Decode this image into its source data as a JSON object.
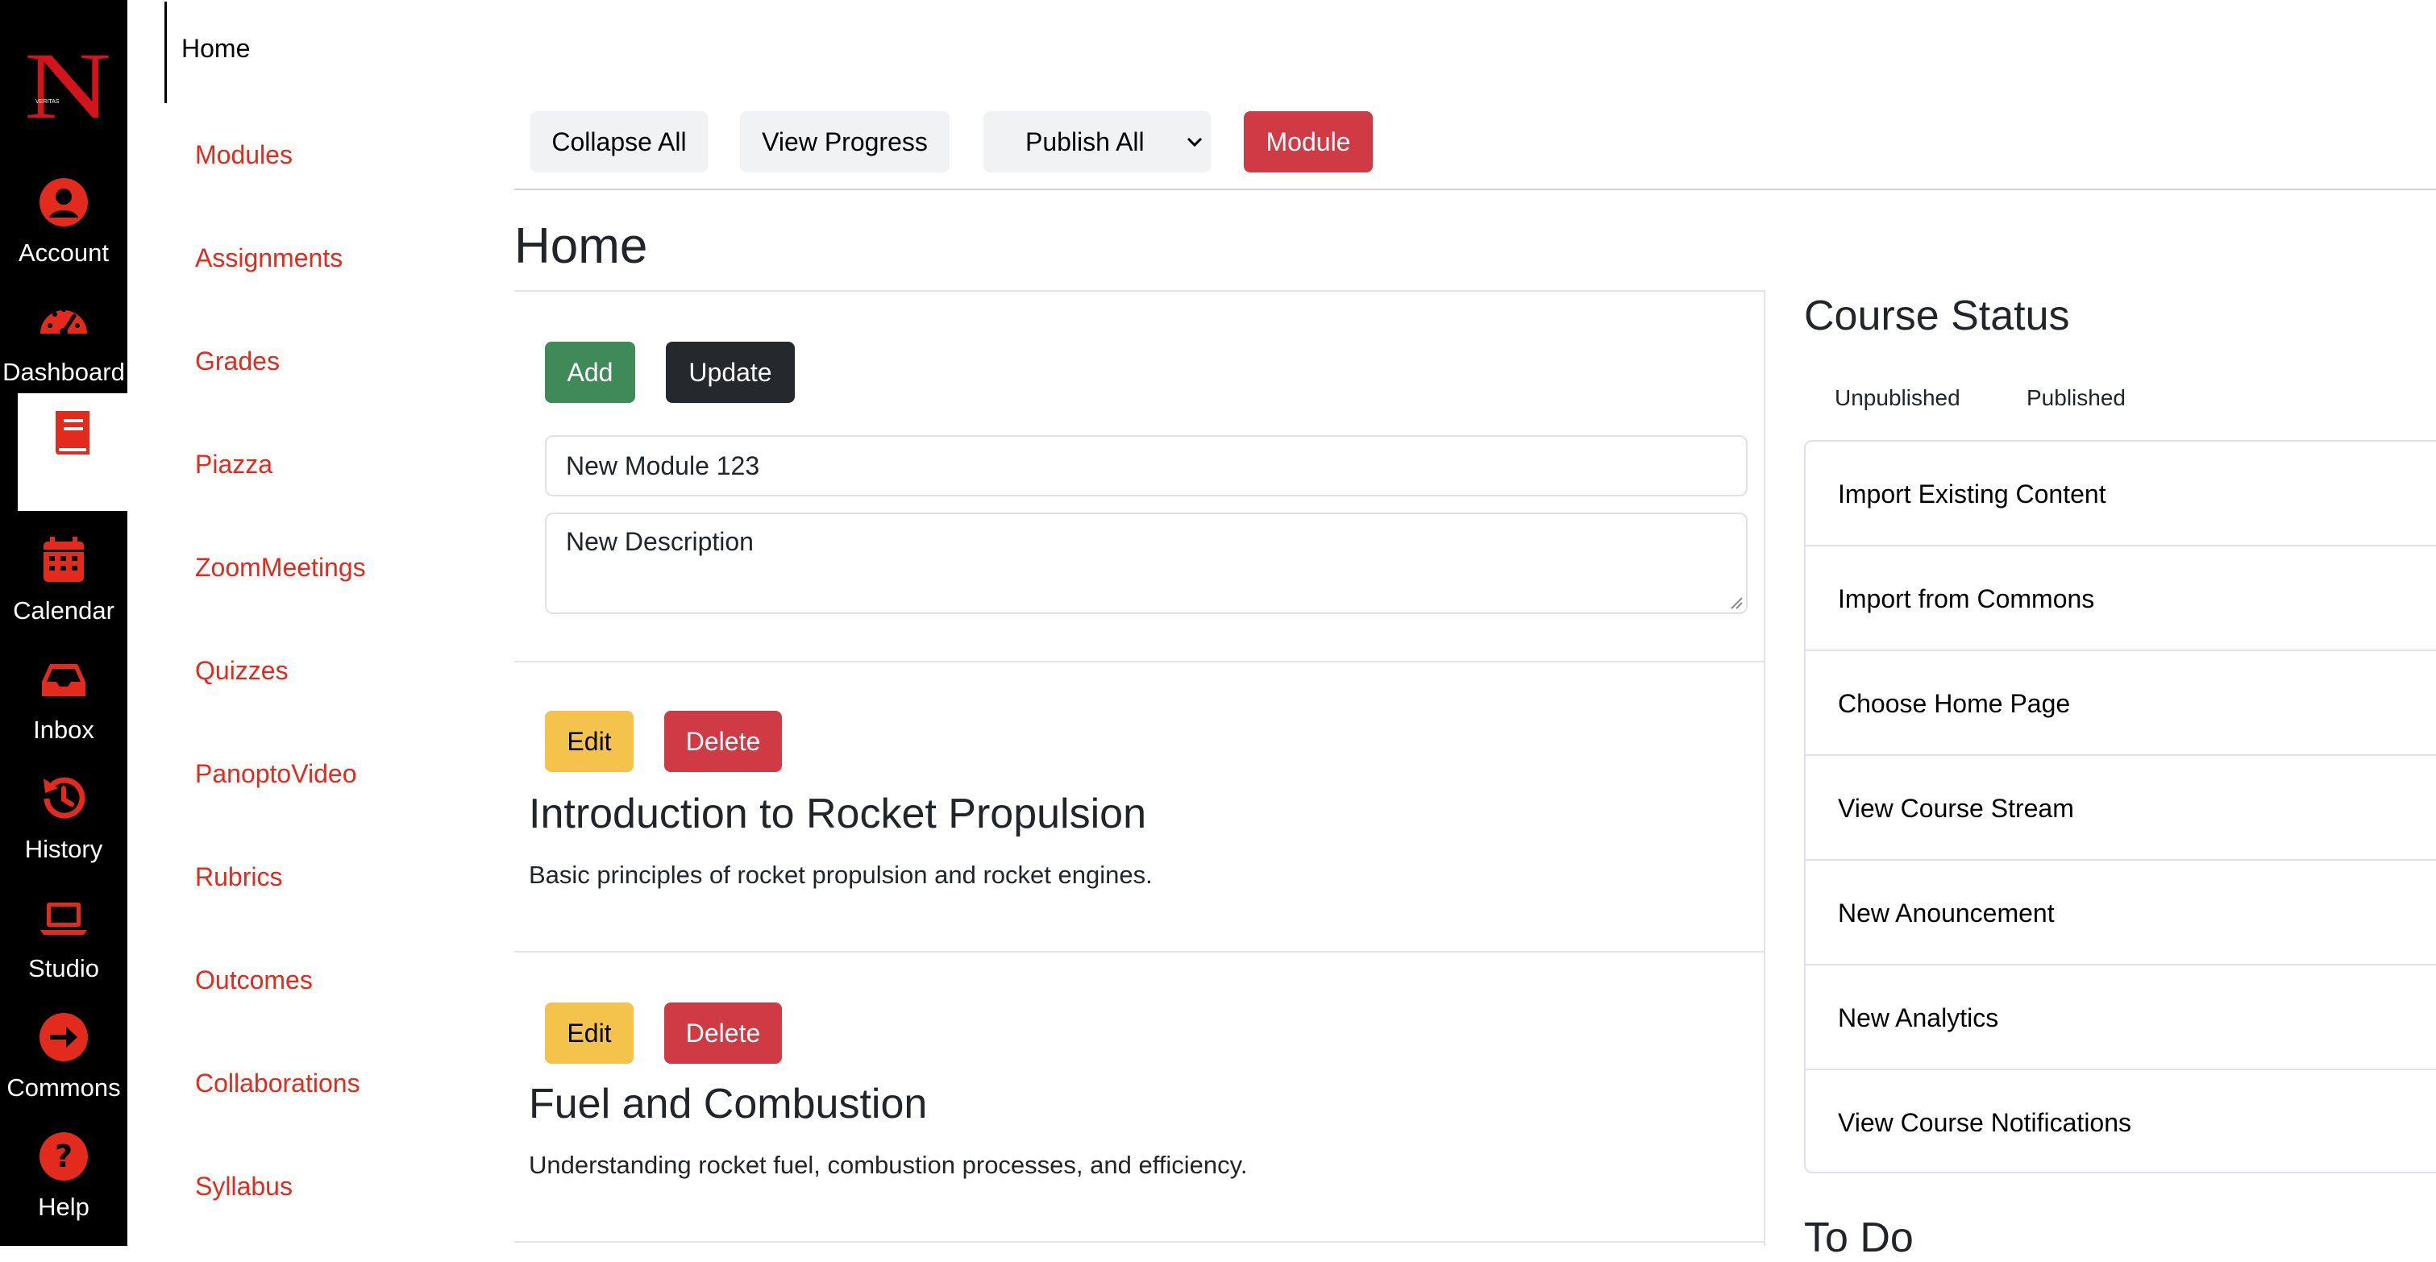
{
  "global_nav": {
    "logo_alt": "N",
    "items": [
      {
        "label": "Account",
        "icon": "account-icon"
      },
      {
        "label": "Dashboard",
        "icon": "dashboard-icon"
      },
      {
        "label": "",
        "icon": "book-icon"
      },
      {
        "label": "Calendar",
        "icon": "calendar-icon"
      },
      {
        "label": "Inbox",
        "icon": "inbox-icon"
      },
      {
        "label": "History",
        "icon": "history-icon"
      },
      {
        "label": "Studio",
        "icon": "laptop-icon"
      },
      {
        "label": "Commons",
        "icon": "arrow-right-circle-icon"
      },
      {
        "label": "Help",
        "icon": "help-icon"
      }
    ],
    "accent_color": "#e22b1d"
  },
  "course_nav": {
    "home": "Home",
    "links": [
      "Modules",
      "Assignments",
      "Grades",
      "Piazza",
      "ZoomMeetings",
      "Quizzes",
      "PanoptoVideo",
      "Rubrics",
      "Outcomes",
      "Collaborations",
      "Syllabus"
    ]
  },
  "toolbar": {
    "collapse_all": "Collapse All",
    "view_progress": "View Progress",
    "publish_all": "Publish All",
    "module": "Module"
  },
  "page": {
    "title": "Home"
  },
  "editor": {
    "add": "Add",
    "update": "Update",
    "name_value": "New Module 123",
    "description_value": "New Description"
  },
  "modules": [
    {
      "edit": "Edit",
      "delete": "Delete",
      "title": "Introduction to Rocket Propulsion",
      "description": "Basic principles of rocket propulsion and rocket engines."
    },
    {
      "edit": "Edit",
      "delete": "Delete",
      "title": "Fuel and Combustion",
      "description": "Understanding rocket fuel, combustion processes, and efficiency."
    }
  ],
  "course_status": {
    "title": "Course Status",
    "tabs": [
      "Unpublished",
      "Published"
    ],
    "actions": [
      "Import Existing Content",
      "Import from Commons",
      "Choose Home Page",
      "View Course Stream",
      "New Anouncement",
      "New Analytics",
      "View Course Notifications"
    ],
    "todo_heading": "To Do"
  }
}
